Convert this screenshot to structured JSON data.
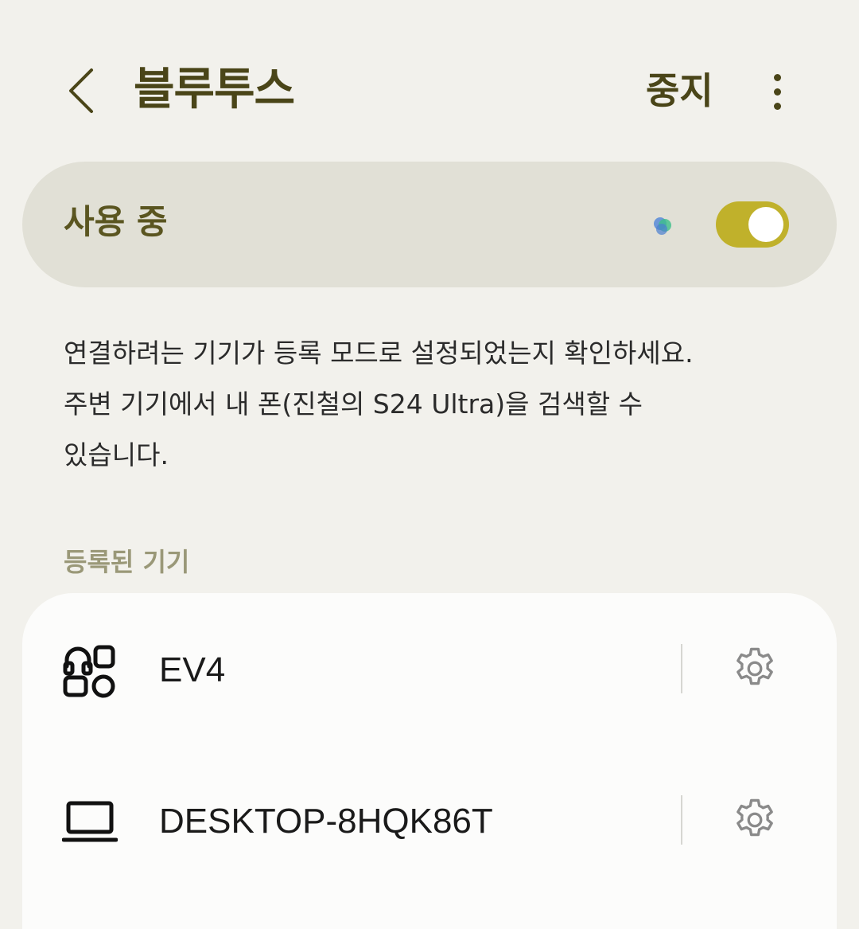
{
  "header": {
    "title": "블루투스",
    "stop_label": "중지"
  },
  "master_switch": {
    "label": "사용 중",
    "state": "on",
    "accent_color": "#c0b12b"
  },
  "description": {
    "line1": "연결하려는 기기가 등록 모드로 설정되었는지 확인하세요.",
    "line2": "주변 기기에서 내 폰(진철의 S24 Ultra)을 검색할 수",
    "line3": "있습니다."
  },
  "paired_section": {
    "title": "등록된 기기",
    "devices": [
      {
        "name": "EV4",
        "icon": "headset-apps-icon"
      },
      {
        "name": "DESKTOP-8HQK86T",
        "icon": "laptop-icon"
      }
    ]
  }
}
